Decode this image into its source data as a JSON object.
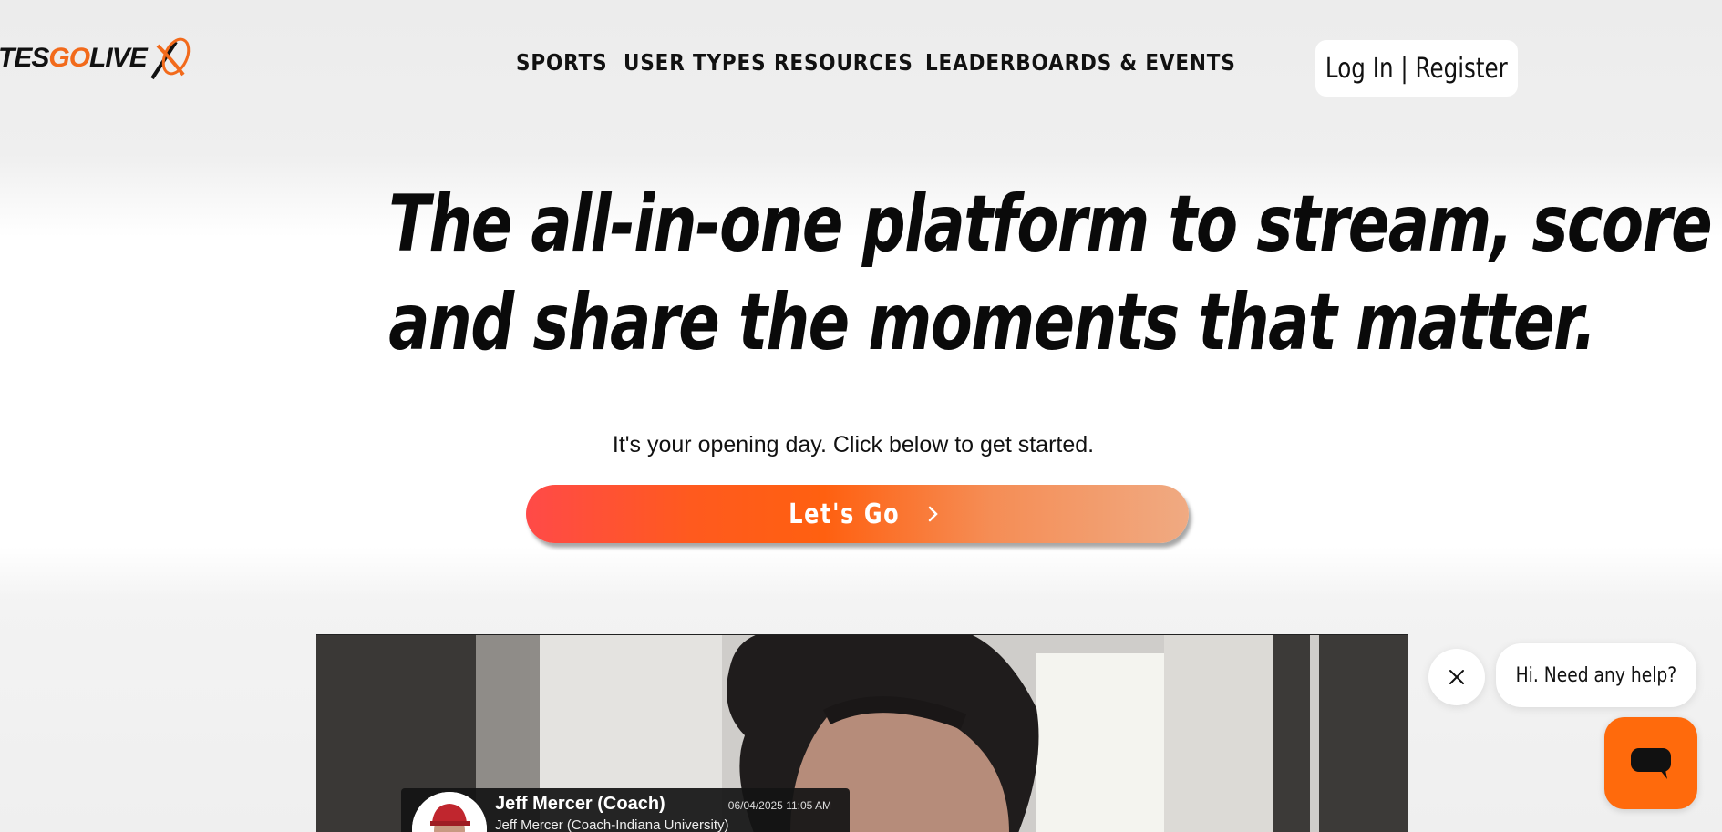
{
  "header": {
    "logo": {
      "part1": "TES",
      "part2": "GO",
      "part3": "LIVE"
    },
    "nav": [
      {
        "label": "SPORTS"
      },
      {
        "label": "USER TYPES"
      },
      {
        "label": "RESOURCES"
      },
      {
        "label": "LEADERBOARDS & EVENTS"
      }
    ],
    "login_label": "Log In | Register"
  },
  "hero": {
    "title_line1": "The all-in-one platform to stream, score",
    "title_line2": "and share the moments that matter.",
    "subtitle": "It's your opening day. Click below to get started.",
    "cta_label": "Let's Go",
    "cta_icon": "chevron-right-icon"
  },
  "video": {
    "overlay": {
      "name": "Jeff Mercer (Coach)",
      "datetime": "06/04/2025 11:05 AM",
      "subtitle": "Jeff Mercer (Coach-Indiana University)"
    }
  },
  "chat": {
    "greeting": "Hi. Need any help?",
    "close_icon": "close-icon",
    "launcher_icon": "chat-icon"
  },
  "colors": {
    "brand_orange": "#f26a1b",
    "cta_gradient_start": "#ff4a48",
    "cta_gradient_end": "#f0aa82",
    "chat_button": "#ff6a0c"
  }
}
